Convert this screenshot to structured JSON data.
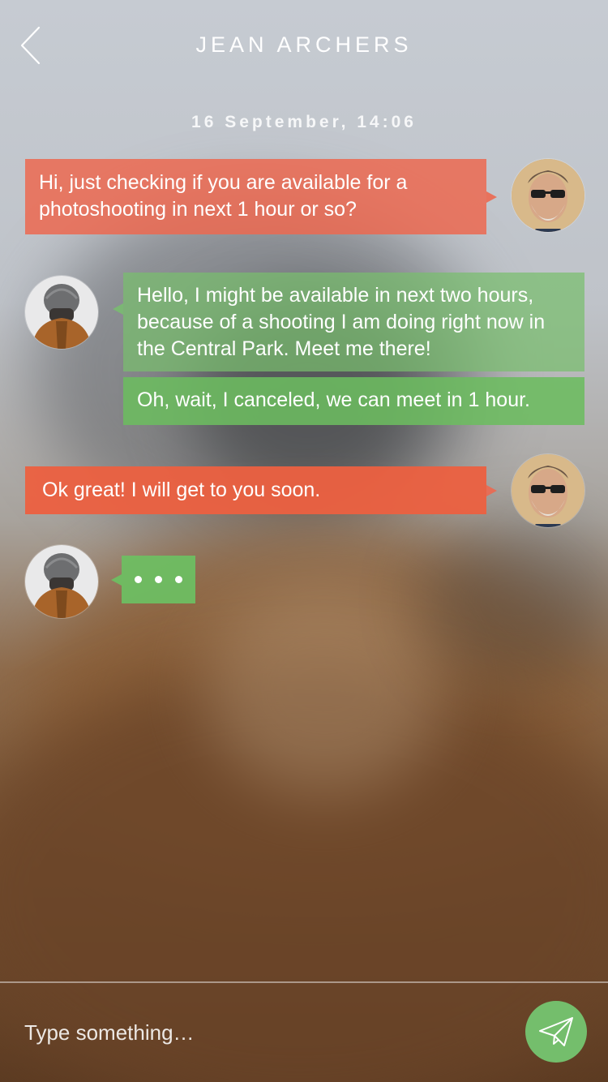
{
  "header": {
    "title": "JEAN ARCHERS",
    "back_icon": "chevron-left-icon"
  },
  "conversation": {
    "date_label": "16 September, 14:06",
    "messages": [
      {
        "sender": "me",
        "text": "Hi, just checking if you are available for a photoshooting in next 1 hour or so?"
      },
      {
        "sender": "contact",
        "text": "Hello, I might be available in next two hours, because of a shooting I am doing right now in the Central Park. Meet me there!"
      },
      {
        "sender": "contact",
        "text": "Oh, wait, I canceled, we can meet in 1 hour."
      },
      {
        "sender": "me",
        "text": "Ok great! I will get to you soon."
      }
    ],
    "typing_indicator": "contact"
  },
  "composer": {
    "placeholder": "Type something…",
    "send_icon": "paper-plane-icon"
  },
  "colors": {
    "outgoing": "#EC6850",
    "incoming": "#6EBE62",
    "send_button": "#74BE6C"
  }
}
